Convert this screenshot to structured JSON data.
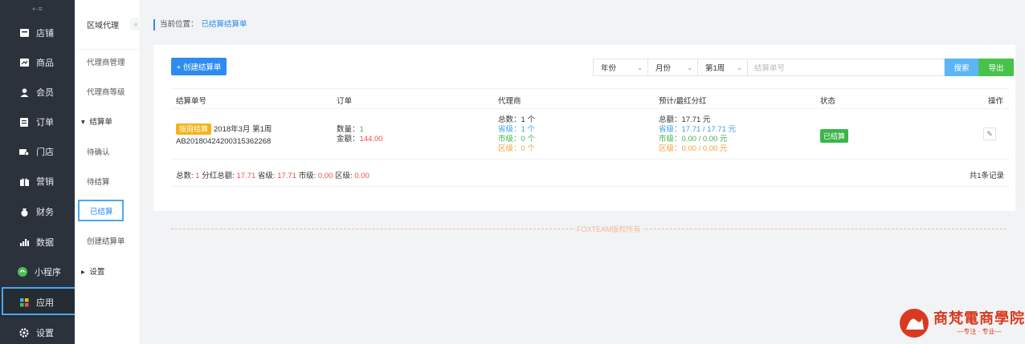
{
  "sidebar": {
    "toggle": "⇠≡",
    "items": [
      {
        "label": "店铺",
        "icon": "store-icon"
      },
      {
        "label": "商品",
        "icon": "goods-icon"
      },
      {
        "label": "会员",
        "icon": "member-icon"
      },
      {
        "label": "订单",
        "icon": "order-icon"
      },
      {
        "label": "门店",
        "icon": "shop-icon"
      },
      {
        "label": "营销",
        "icon": "gift-icon"
      },
      {
        "label": "财务",
        "icon": "finance-icon"
      },
      {
        "label": "数据",
        "icon": "chart-icon"
      },
      {
        "label": "小程序",
        "icon": "miniapp-icon"
      },
      {
        "label": "应用",
        "icon": "apps-icon"
      },
      {
        "label": "设置",
        "icon": "gear-icon"
      }
    ]
  },
  "subnav": {
    "title": "区域代理",
    "collapse": "«",
    "items": [
      {
        "label": "代理商管理"
      },
      {
        "label": "代理商等级"
      },
      {
        "label": "结算单",
        "group": true,
        "arrow": "▾"
      },
      {
        "label": "待确认"
      },
      {
        "label": "待结算"
      },
      {
        "label": "已结算"
      },
      {
        "label": "创建结算单"
      },
      {
        "label": "设置",
        "group": true,
        "arrow": "▸"
      }
    ]
  },
  "breadcrumb": {
    "prefix": "当前位置：",
    "current": "已结算结算单"
  },
  "toolbar": {
    "create": "+ 创建结算单",
    "year": "年份",
    "month": "月份",
    "week": "第1周",
    "search_placeholder": "结算单号",
    "search": "搜索",
    "export": "导出",
    "chevron": "⌄"
  },
  "table": {
    "headers": [
      "结算单号",
      "订单",
      "代理商",
      "预计/最红分红",
      "状态",
      "操作"
    ],
    "row": {
      "tag": "按周结算",
      "period": "2018年3月 第1周",
      "no": "AB20180424200315362268",
      "qty_label": "数量：",
      "qty": "1",
      "amount_label": "金额：",
      "amount": "144.00",
      "agent_total_label": "总数：",
      "agent_total": "1 个",
      "agent_prov_label": "省级：",
      "agent_prov": "1 个",
      "agent_city_label": "市级：",
      "agent_city": "0 个",
      "agent_dist_label": "区级：",
      "agent_dist": "0 个",
      "div_total_label": "总额：",
      "div_total": "17.71 元",
      "div_prov_label": "省级：",
      "div_prov": "17.71 / 17.71 元",
      "div_city_label": "市级：",
      "div_city": "0.00 / 0.00 元",
      "div_dist_label": "区级：",
      "div_dist": "0.00 / 0.00 元",
      "status": "已结算",
      "edit": "✎"
    },
    "footer": {
      "total_label": "总数: ",
      "total": "1",
      "div_label": " 分红总额: ",
      "div": "17.71",
      "prov_label": " 省级: ",
      "prov": "17.71",
      "city_label": " 市级: ",
      "city": "0.00",
      "dist_label": " 区级: ",
      "dist": "0.00",
      "count": "共1条记录"
    }
  },
  "copyright": "FOXTEAM版权所有",
  "logo": {
    "main": "商梵電商學院",
    "sub": "—专注 · 专业—"
  }
}
